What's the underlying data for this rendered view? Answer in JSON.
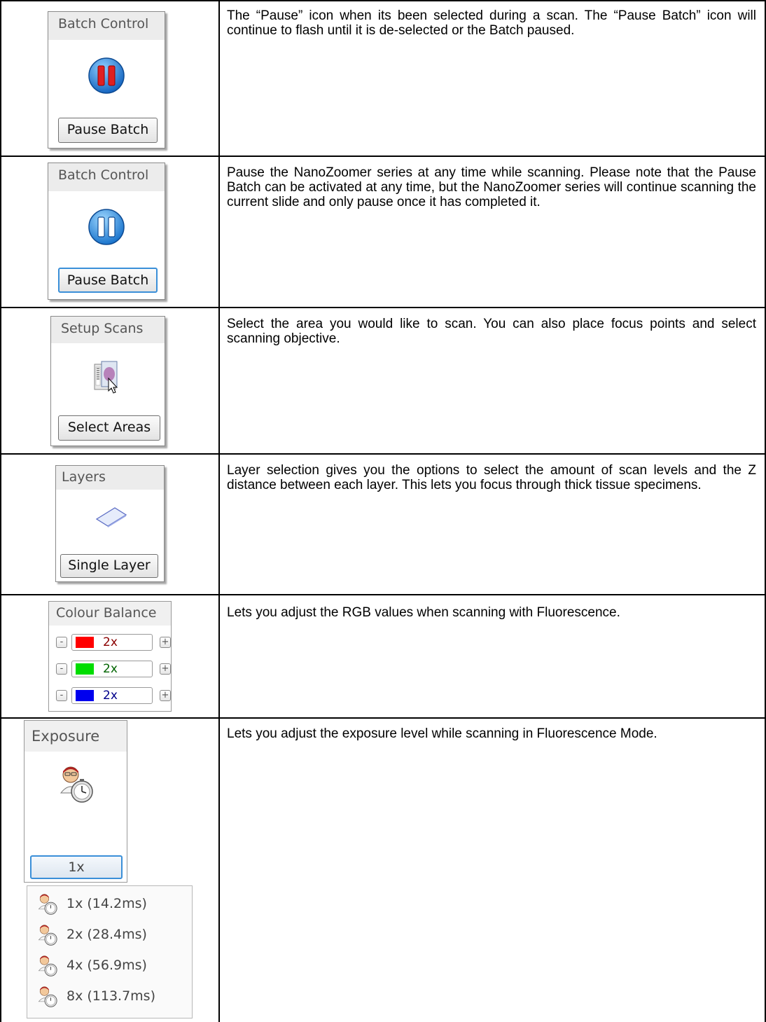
{
  "rows": [
    {
      "widget": {
        "title": "Batch Control",
        "button": "Pause Batch",
        "icon": "pause-active-icon",
        "icon_color": "#e02020"
      },
      "text": "The “Pause” icon when its been selected during a scan. The “Pause Batch” icon will continue to flash until it is de-selected or the Batch paused."
    },
    {
      "widget": {
        "title": "Batch Control",
        "button": "Pause Batch",
        "icon": "pause-icon",
        "icon_color": "#2a7fd4"
      },
      "text": "Pause the NanoZoomer series at any time while scanning. Please note that the Pause Batch can be activated at any time, but the NanoZoomer series will continue scanning the current slide and only pause once it has completed it."
    },
    {
      "widget": {
        "title": "Setup Scans",
        "button": "Select Areas",
        "icon": "slide-select-icon"
      },
      "text": "Select the area you would like to scan. You can also place focus points and select scanning objective."
    },
    {
      "widget": {
        "title": "Layers",
        "button": "Single Layer",
        "icon": "single-layer-icon"
      },
      "text": "Layer selection gives you the options to select the amount of scan levels and the Z distance between each layer. This lets you focus through thick tissue specimens."
    },
    {
      "widget": {
        "title": "Colour Balance",
        "channels": [
          {
            "color": "#ff0000",
            "value": "2x",
            "text_color": "#8b0000",
            "minus": "-",
            "plus": "+"
          },
          {
            "color": "#00dd00",
            "value": "2x",
            "text_color": "#006400",
            "minus": "-",
            "plus": "+"
          },
          {
            "color": "#0000ee",
            "value": "2x",
            "text_color": "#00008b",
            "minus": "-",
            "plus": "+"
          }
        ]
      },
      "text": "Lets you adjust the RGB values when scanning with Fluorescence."
    },
    {
      "widget": {
        "title": "Exposure",
        "button": "1x",
        "icon": "exposure-stopwatch-icon",
        "options": [
          "1x (14.2ms)",
          "2x (28.4ms)",
          "4x (56.9ms)",
          "8x (113.7ms)"
        ]
      },
      "text": "Lets you adjust the exposure level while scanning in Fluorescence Mode."
    }
  ]
}
